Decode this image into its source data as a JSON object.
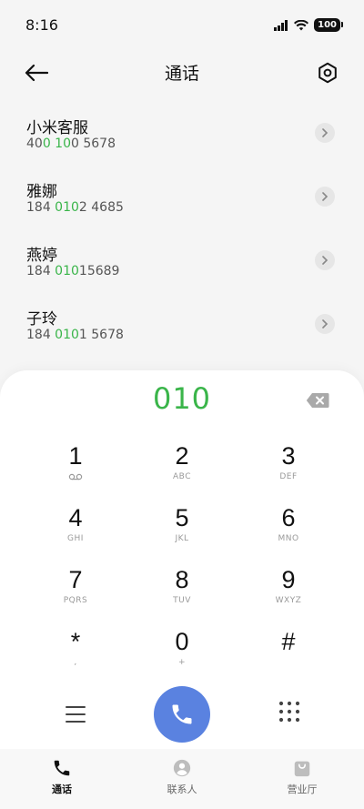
{
  "status_bar": {
    "time": "8:16",
    "battery": "100"
  },
  "header": {
    "title": "通话"
  },
  "contacts": [
    {
      "name": "小米客服",
      "number_parts": [
        "40",
        "0 10",
        "0 5678"
      ]
    },
    {
      "name": "雅娜",
      "number_parts": [
        "184 ",
        "010",
        "2 4685"
      ]
    },
    {
      "name": "燕婷",
      "number_parts": [
        "184 ",
        "010",
        "15689"
      ]
    },
    {
      "name": "子玲",
      "number_parts": [
        "184 ",
        "010",
        "1 5678"
      ]
    }
  ],
  "dialer": {
    "display": "010",
    "keys": [
      {
        "digit": "1",
        "sub": ""
      },
      {
        "digit": "2",
        "sub": "ABC"
      },
      {
        "digit": "3",
        "sub": "DEF"
      },
      {
        "digit": "4",
        "sub": "GHI"
      },
      {
        "digit": "5",
        "sub": "JKL"
      },
      {
        "digit": "6",
        "sub": "MNO"
      },
      {
        "digit": "7",
        "sub": "PQRS"
      },
      {
        "digit": "8",
        "sub": "TUV"
      },
      {
        "digit": "9",
        "sub": "WXYZ"
      },
      {
        "digit": "*",
        "sub": ","
      },
      {
        "digit": "0",
        "sub": "+"
      },
      {
        "digit": "#",
        "sub": ""
      }
    ]
  },
  "tabs": [
    {
      "label": "通话",
      "icon": "phone-icon",
      "active": true
    },
    {
      "label": "联系人",
      "icon": "contact-icon",
      "active": false
    },
    {
      "label": "营业厅",
      "icon": "shopping-bag-icon",
      "active": false
    }
  ],
  "colors": {
    "highlight": "#3ab54a",
    "call_button": "#5a82e0"
  }
}
